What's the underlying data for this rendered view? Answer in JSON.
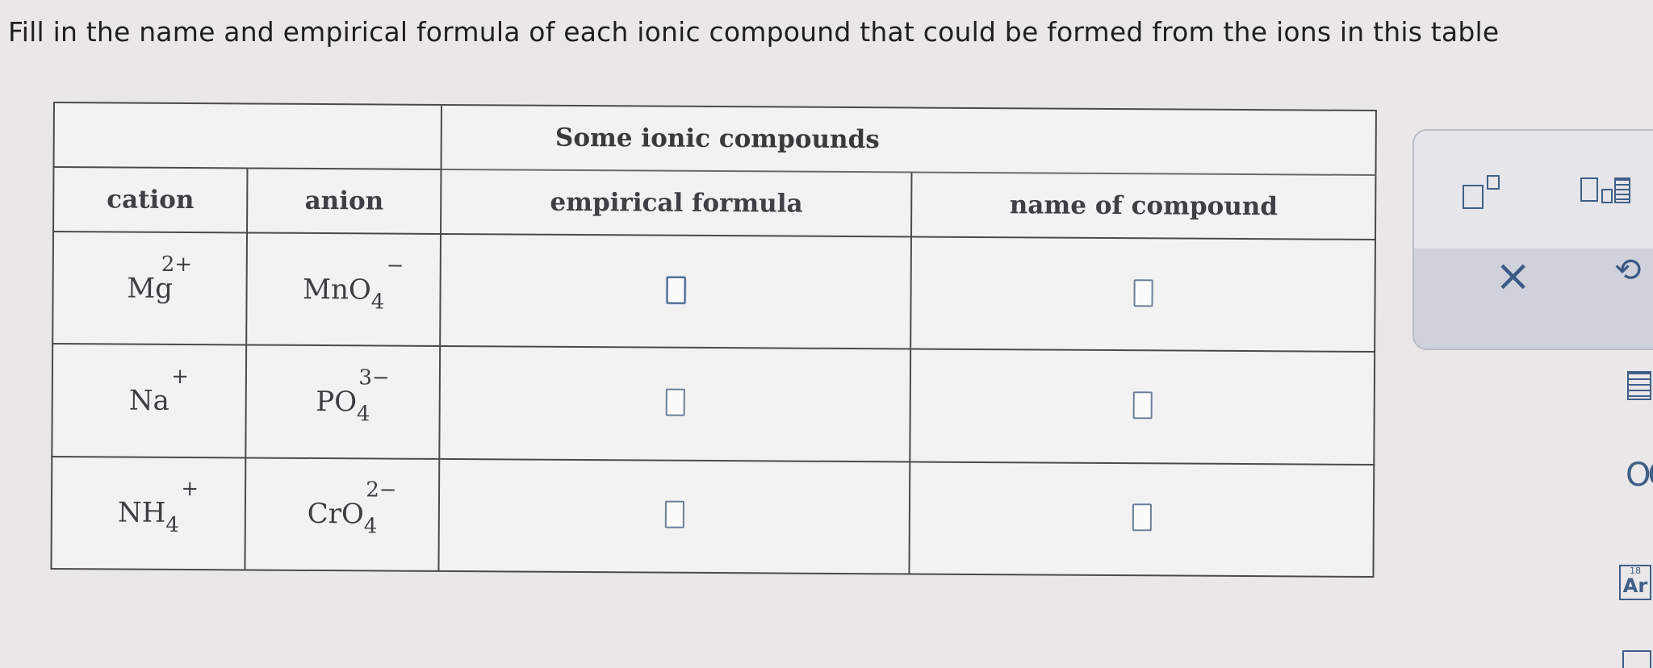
{
  "instruction": "Fill in the name and empirical formula of each ionic compound that could be formed from the ions in this table",
  "table": {
    "title": "Some ionic compounds",
    "headers": {
      "cation": "cation",
      "anion": "anion",
      "formula": "empirical formula",
      "name": "name of compound"
    },
    "rows": [
      {
        "cation": {
          "base": "Mg",
          "sub": "",
          "sup": "2+"
        },
        "anion": {
          "base": "MnO",
          "sub": "4",
          "sup": "−"
        }
      },
      {
        "cation": {
          "base": "Na",
          "sub": "",
          "sup": "+"
        },
        "anion": {
          "base": "PO",
          "sub": "4",
          "sup": "3−"
        }
      },
      {
        "cation": {
          "base": "NH",
          "sub": "4",
          "sup": "+"
        },
        "anion": {
          "base": "CrO",
          "sub": "4",
          "sup": "2−"
        }
      }
    ]
  },
  "toolbar": {
    "close_symbol": "×",
    "undo_symbol": "⟲",
    "element_number": "18",
    "element_symbol": "Ar"
  },
  "icons": [
    "superscript-box-icon",
    "subscript-box-icon",
    "close-icon",
    "undo-icon",
    "equation-icon",
    "dots-icon",
    "periodic-element-icon"
  ],
  "colors": {
    "accent": "#3f5f88",
    "border": "#4a4a4d",
    "background": "#e9e7e8"
  }
}
